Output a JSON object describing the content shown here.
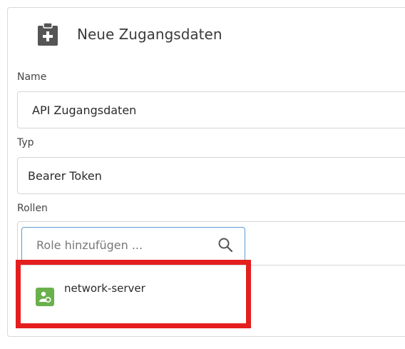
{
  "header": {
    "title": "Neue Zugangsdaten",
    "icon": "clipboard-add-icon"
  },
  "form": {
    "name": {
      "label": "Name",
      "value": "API Zugangsdaten"
    },
    "type": {
      "label": "Typ",
      "value": "Bearer Token"
    },
    "roles": {
      "label": "Rollen",
      "search_placeholder": "Role hinzufügen ...",
      "search_icon": "search-icon"
    }
  },
  "dropdown": {
    "items": [
      {
        "label": "network-server",
        "icon": "role-icon"
      }
    ],
    "highlight_color": "#e41e1e"
  }
}
